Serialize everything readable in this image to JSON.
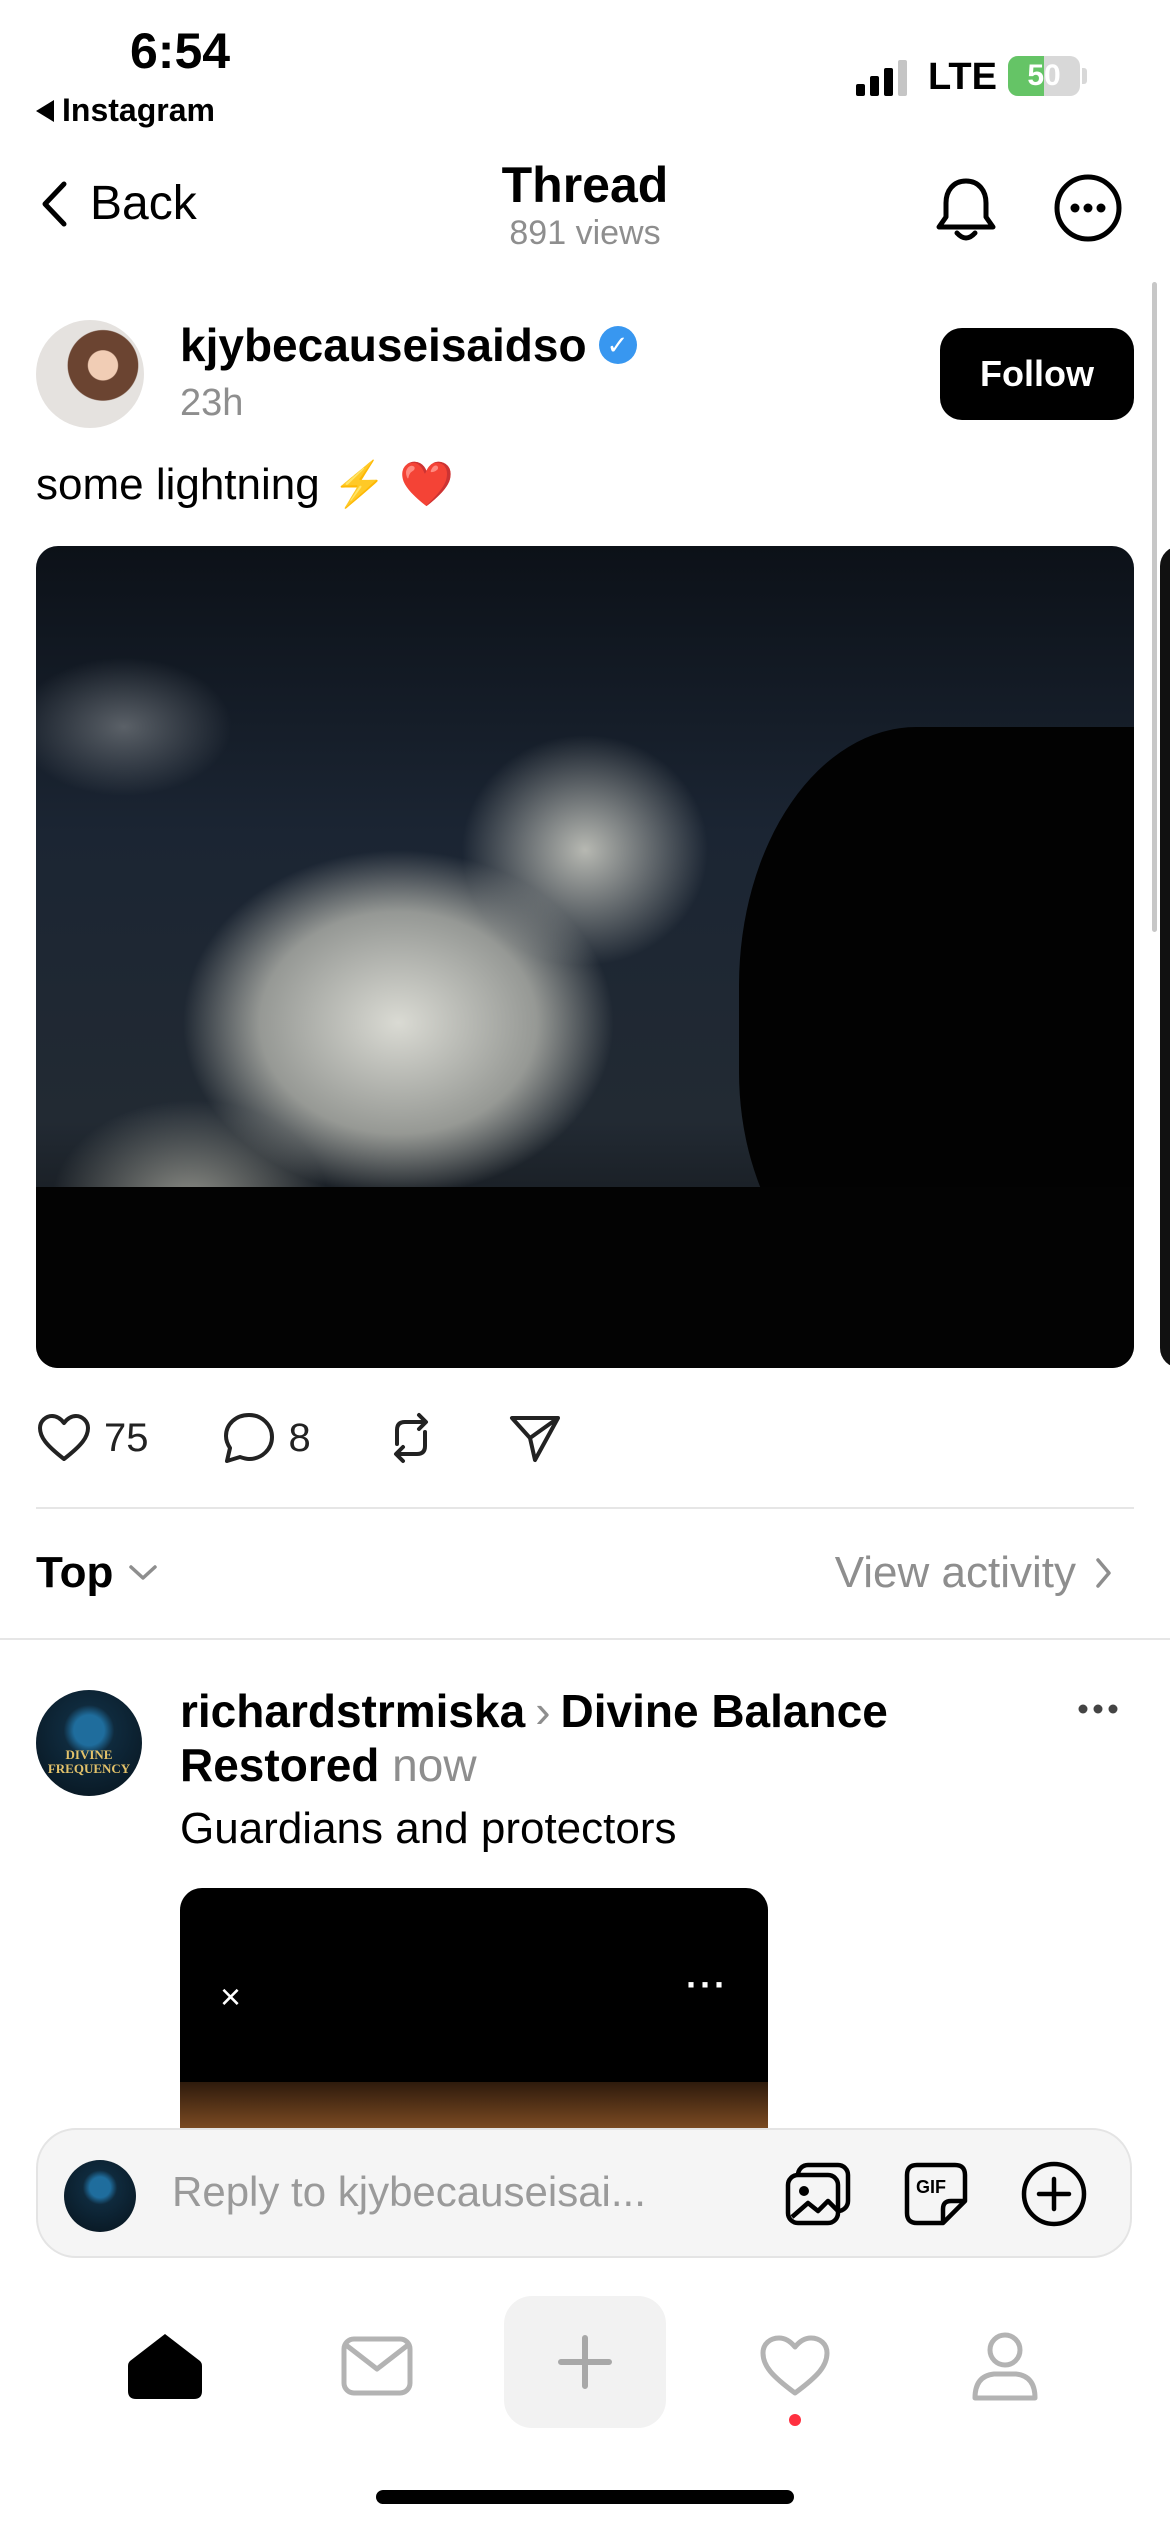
{
  "status_bar": {
    "time": "6:54",
    "back_app": "Instagram",
    "network": "LTE",
    "battery_level": "50",
    "battery_fill": 0.5,
    "signal_bars_active": 3
  },
  "header": {
    "back_label": "Back",
    "title": "Thread",
    "views": "891 views"
  },
  "post": {
    "username": "kjybecauseisaidso",
    "time": "23h",
    "follow_label": "Follow",
    "text": "some lightning ⚡️ ❤️",
    "likes": "75",
    "comments": "8"
  },
  "sort": {
    "label": "Top",
    "view_activity": "View activity"
  },
  "reply": {
    "username": "richardstrmiska",
    "context_a": "Divine Balance",
    "context_b": "Restored",
    "time": "now",
    "avatar_text_1": "DIVINE",
    "avatar_text_2": "FREQUENCY",
    "text": "Guardians and protectors",
    "video_close": "×",
    "video_more": "···"
  },
  "composer": {
    "placeholder": "Reply to kjybecauseisai...",
    "gif_label": "GIF"
  },
  "tab_bar": {
    "items": [
      "home-icon",
      "inbox-icon",
      "create-icon",
      "activity-icon",
      "profile-icon"
    ],
    "activity_badge_color": "#ff3040"
  },
  "colors": {
    "accent": "#3897f0",
    "secondary_text": "#8e8e8e",
    "battery_green": "#65c466"
  }
}
